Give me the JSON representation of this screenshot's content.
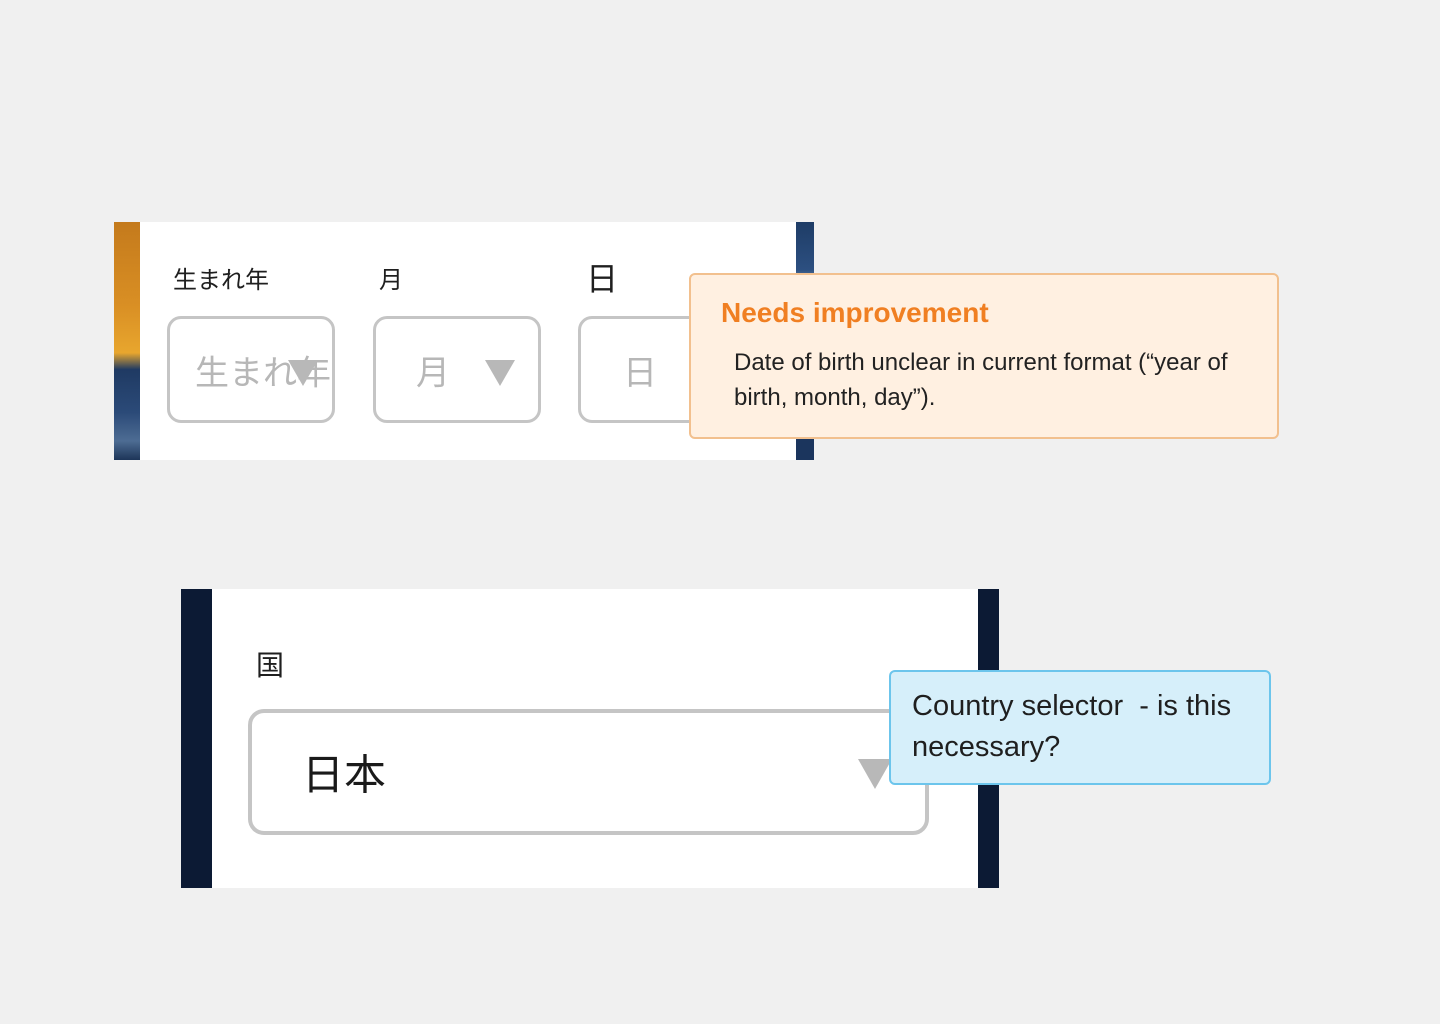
{
  "date_of_birth_form": {
    "year": {
      "label": "生まれ年",
      "placeholder": "生まれ年"
    },
    "month": {
      "label": "月",
      "placeholder": "月"
    },
    "day": {
      "label": "日",
      "placeholder": "日"
    }
  },
  "improvement_callout": {
    "title": "Needs improvement",
    "body": "Date of birth unclear in current format (“year of birth, month, day”).",
    "accent_color": "#f07f22",
    "background_color": "#fff0e1"
  },
  "country_form": {
    "label": "国",
    "selected_value": "日本"
  },
  "country_callout": {
    "body": "Country selector  - is this necessary?",
    "background_color": "#d6effa",
    "border_color": "#6cc5ec"
  }
}
